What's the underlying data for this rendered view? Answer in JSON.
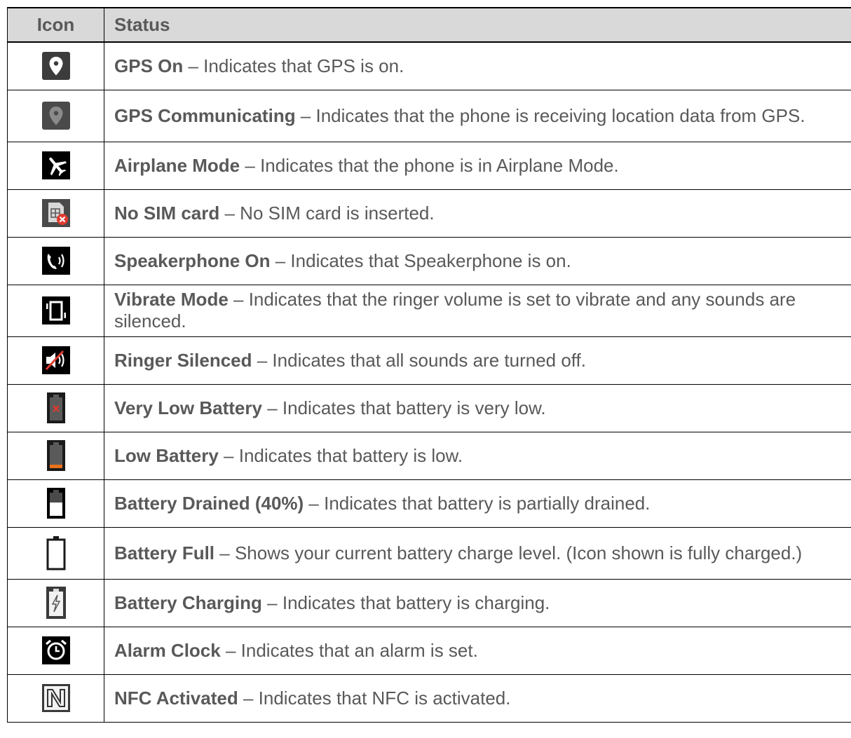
{
  "table": {
    "headers": {
      "icon": "Icon",
      "status": "Status"
    },
    "rows": [
      {
        "icon": "gps-on-icon",
        "title": "GPS On",
        "description": "Indicates that GPS is on."
      },
      {
        "icon": "gps-communicating-icon",
        "title": "GPS Communicating",
        "description": "Indicates that the phone is receiving location data from GPS."
      },
      {
        "icon": "airplane-mode-icon",
        "title": "Airplane Mode",
        "description": "Indicates that the phone is in Airplane Mode."
      },
      {
        "icon": "no-sim-card-icon",
        "title": "No SIM card",
        "description": "No SIM card is inserted."
      },
      {
        "icon": "speakerphone-icon",
        "title": "Speakerphone On",
        "description": "Indicates that Speakerphone is on."
      },
      {
        "icon": "vibrate-mode-icon",
        "title": "Vibrate Mode",
        "description": "Indicates that the ringer volume is set to vibrate and any sounds are silenced."
      },
      {
        "icon": "ringer-silenced-icon",
        "title": "Ringer Silenced",
        "description": "Indicates that all sounds are turned off."
      },
      {
        "icon": "very-low-battery-icon",
        "title": "Very Low Battery",
        "description": "Indicates that battery is very low."
      },
      {
        "icon": "low-battery-icon",
        "title": "Low Battery",
        "description": "Indicates that battery is low."
      },
      {
        "icon": "battery-drained-icon",
        "title": "Battery Drained (40%)",
        "description": "Indicates that battery is partially drained."
      },
      {
        "icon": "battery-full-icon",
        "title": "Battery Full",
        "description": "Shows your current battery charge level. (Icon shown is fully charged.)"
      },
      {
        "icon": "battery-charging-icon",
        "title": "Battery Charging",
        "description": "Indicates that battery is charging."
      },
      {
        "icon": "alarm-clock-icon",
        "title": "Alarm Clock",
        "description": "Indicates that an alarm is set."
      },
      {
        "icon": "nfc-activated-icon",
        "title": "NFC Activated",
        "description": "Indicates that NFC is activated."
      }
    ],
    "separator": " – "
  },
  "colors": {
    "text": "#595959",
    "header_bg": "#d9d9d9",
    "border": "#000000",
    "alert_red": "#e03a2f",
    "battery_orange": "#e8731c"
  }
}
